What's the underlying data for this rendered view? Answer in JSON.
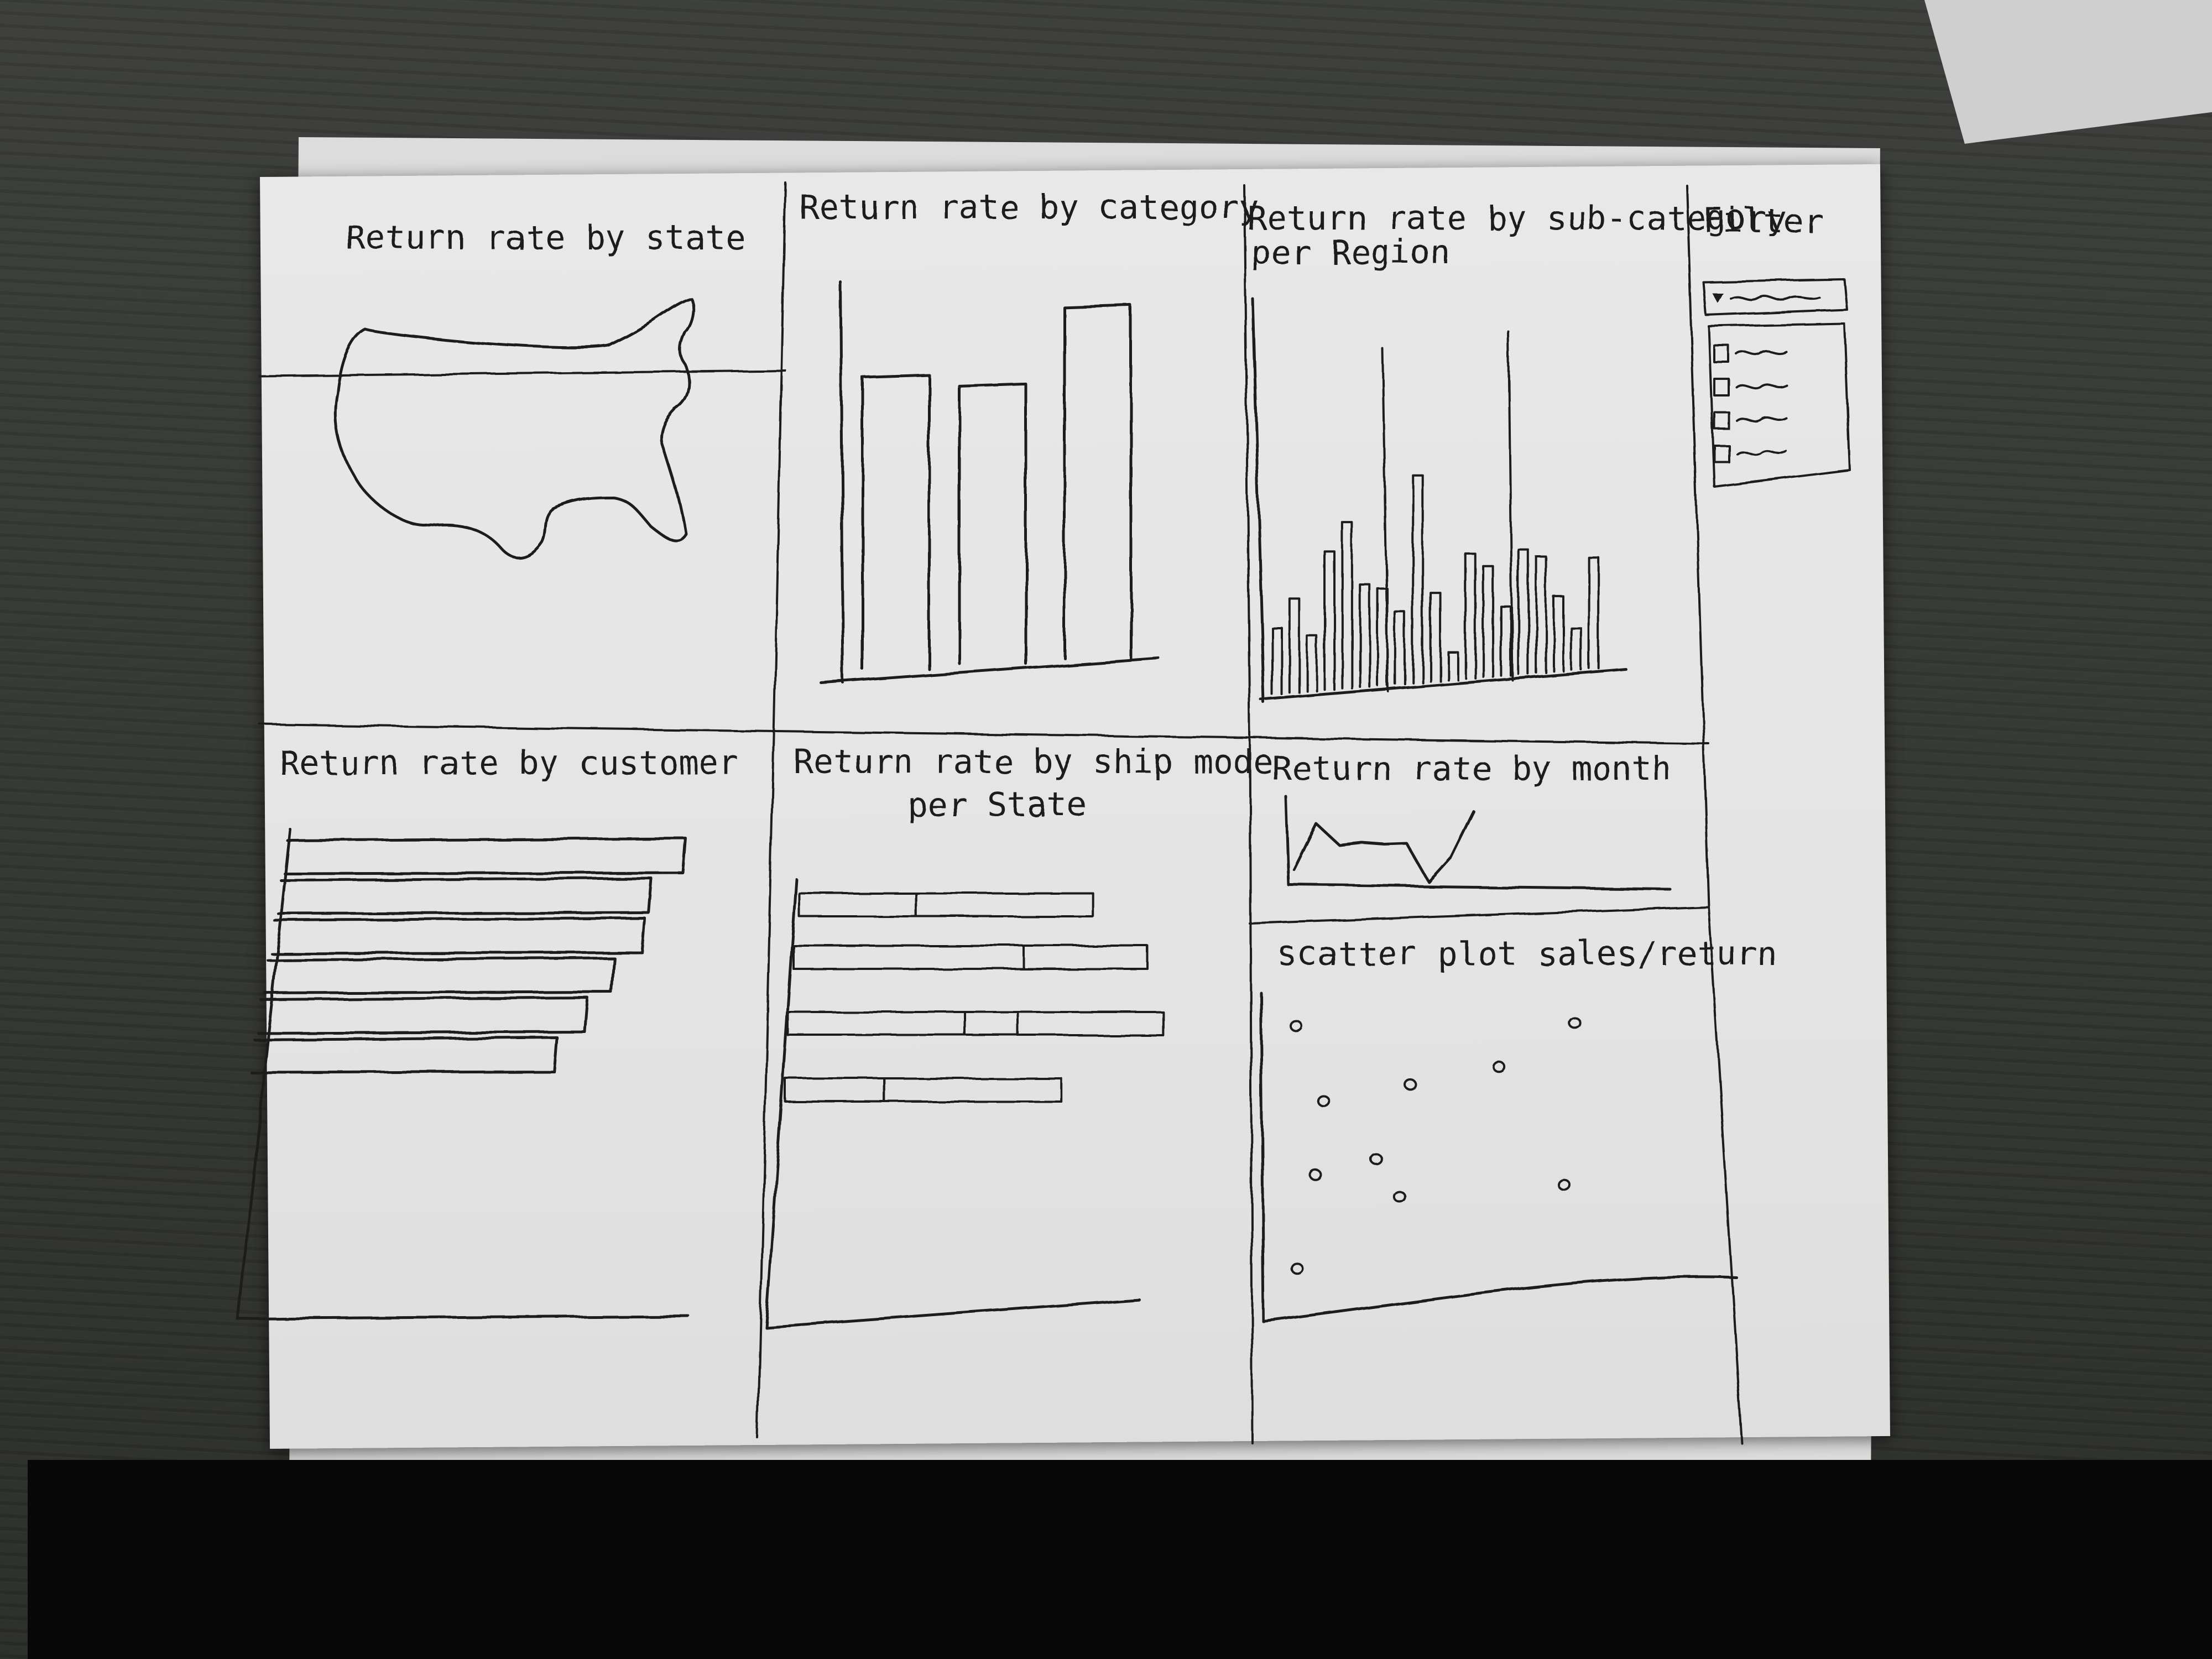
{
  "panels": {
    "state": {
      "title": "Return rate by state"
    },
    "category": {
      "title": "Return rate by category",
      "bar_heights": [
        0.8,
        0.76,
        0.96
      ]
    },
    "subcategory": {
      "title_line1": "Return rate by sub-category",
      "title_line2": "per Region",
      "bar_heights": [
        0.24,
        0.34,
        0.2,
        0.5,
        0.6,
        0.37,
        0.35,
        0.26,
        0.75,
        0.32,
        0.1,
        0.45,
        0.4,
        0.25,
        0.45,
        0.42,
        0.27,
        0.15,
        0.4
      ]
    },
    "customer": {
      "title": "Return rate by customer",
      "bar_lengths": [
        1.0,
        0.93,
        0.93,
        0.87,
        0.82,
        0.76
      ]
    },
    "shipmode": {
      "title_line1": "Return rate by ship mode",
      "title_line2": "per State",
      "rows": [
        [
          0.33,
          0.5
        ],
        [
          0.65,
          0.35
        ],
        [
          0.5,
          0.15,
          0.41
        ],
        [
          0.28,
          0.5
        ]
      ]
    },
    "month": {
      "title": "Return rate by month",
      "values": [
        0.15,
        0.7,
        0.45,
        0.48,
        0.46,
        0.47,
        0.0,
        0.3,
        0.85
      ]
    },
    "scatter": {
      "title": "scatter plot sales/return",
      "points": [
        [
          0.05,
          0.9
        ],
        [
          0.78,
          0.91
        ],
        [
          0.58,
          0.77
        ],
        [
          0.35,
          0.71
        ],
        [
          0.12,
          0.66
        ],
        [
          0.26,
          0.47
        ],
        [
          0.1,
          0.42
        ],
        [
          0.32,
          0.35
        ],
        [
          0.75,
          0.39
        ],
        [
          0.05,
          0.12
        ]
      ]
    },
    "filter": {
      "title": "Filter",
      "dropdown_icon": "dropdown-triangle-icon",
      "checkbox_count": 4
    }
  }
}
